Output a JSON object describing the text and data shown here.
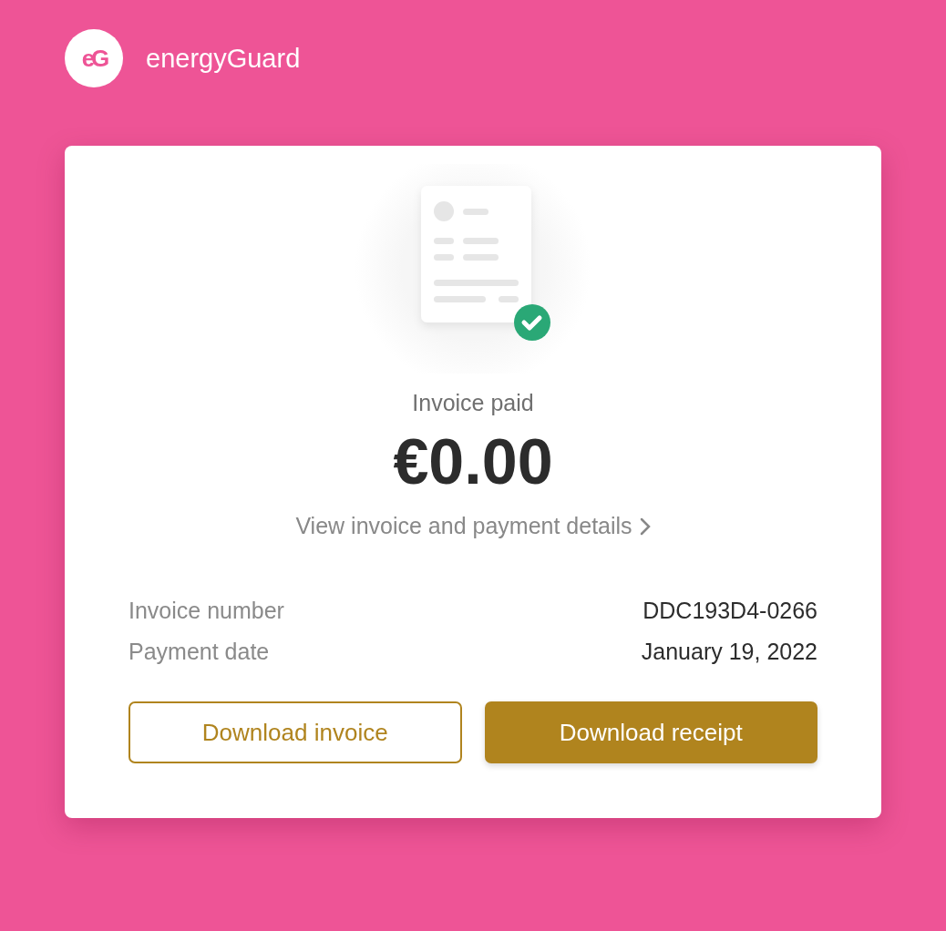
{
  "brand": {
    "logo_text": "eG",
    "name": "energyGuard"
  },
  "invoice": {
    "status": "Invoice paid",
    "amount": "€0.00",
    "details_link": "View invoice and payment details",
    "fields": [
      {
        "label": "Invoice number",
        "value": "DDC193D4-0266"
      },
      {
        "label": "Payment date",
        "value": "January 19, 2022"
      }
    ],
    "buttons": [
      {
        "label": "Download invoice",
        "kind": "outline"
      },
      {
        "label": "Download receipt",
        "kind": "filled"
      }
    ]
  }
}
